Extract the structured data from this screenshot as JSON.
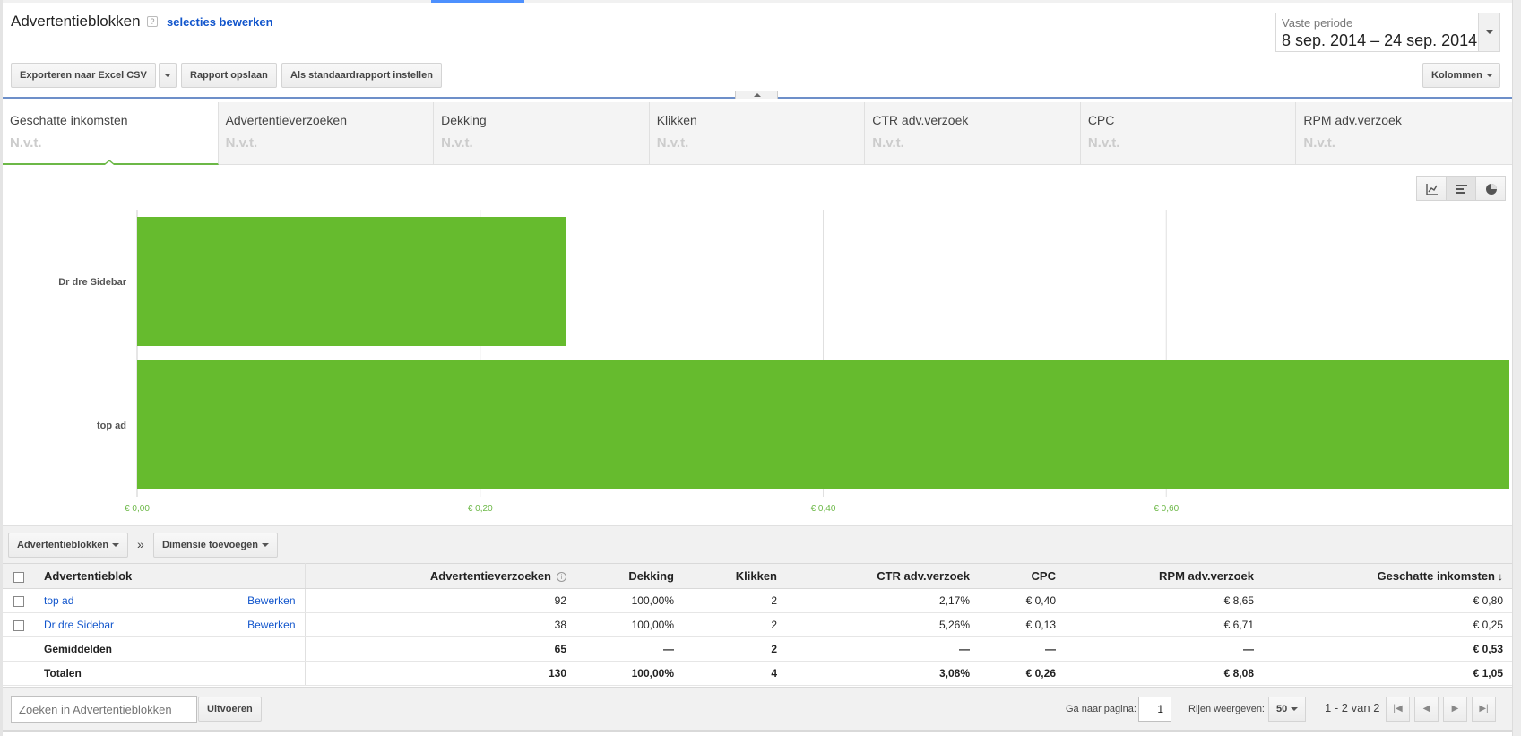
{
  "header": {
    "title": "Advertentieblokken",
    "help": "?",
    "edit_selection": "selecties bewerken",
    "date_label": "Vaste periode",
    "date_value": "8 sep. 2014 – 24 sep. 2014"
  },
  "toolbar": {
    "export": "Exporteren naar Excel CSV",
    "save_report": "Rapport opslaan",
    "set_default": "Als standaardrapport instellen",
    "columns": "Kolommen"
  },
  "metrics": [
    {
      "label": "Geschatte inkomsten",
      "value": "N.v.t."
    },
    {
      "label": "Advertentieverzoeken",
      "value": "N.v.t."
    },
    {
      "label": "Dekking",
      "value": "N.v.t."
    },
    {
      "label": "Klikken",
      "value": "N.v.t."
    },
    {
      "label": "CTR adv.verzoek",
      "value": "N.v.t."
    },
    {
      "label": "CPC",
      "value": "N.v.t."
    },
    {
      "label": "RPM adv.verzoek",
      "value": "N.v.t."
    }
  ],
  "chart_icons": [
    "line-chart-icon",
    "bar-chart-icon",
    "pie-chart-icon"
  ],
  "chart_data": {
    "type": "bar",
    "orientation": "horizontal",
    "categories": [
      "Dr dre Sidebar",
      "top ad"
    ],
    "values": [
      0.25,
      0.8
    ],
    "xlim": [
      0,
      0.8
    ],
    "ticks": [
      0,
      0.2,
      0.4,
      0.6
    ],
    "tick_labels": [
      "€ 0,00",
      "€ 0,20",
      "€ 0,40",
      "€ 0,60"
    ],
    "grid": true,
    "color": "#66bb2e",
    "tick_color": "#6cb847"
  },
  "dimensions": {
    "primary": "Advertentieblokken",
    "separator": "»",
    "add": "Dimensie toevoegen"
  },
  "table": {
    "columns": [
      "Advertentieblok",
      "Advertentieverzoeken",
      "Dekking",
      "Klikken",
      "CTR adv.verzoek",
      "CPC",
      "RPM adv.verzoek",
      "Geschatte inkomsten"
    ],
    "info_mark": "i",
    "sort_mark": "↓",
    "edit_label": "Bewerken",
    "rows": [
      {
        "name": "top ad",
        "cells": [
          "92",
          "100,00%",
          "2",
          "2,17%",
          "€ 0,40",
          "€ 8,65",
          "€ 0,80"
        ]
      },
      {
        "name": "Dr dre Sidebar",
        "cells": [
          "38",
          "100,00%",
          "2",
          "5,26%",
          "€ 0,13",
          "€ 6,71",
          "€ 0,25"
        ]
      }
    ],
    "averages": {
      "name": "Gemiddelden",
      "cells": [
        "65",
        "—",
        "2",
        "—",
        "—",
        "—",
        "€ 0,53"
      ]
    },
    "totals": {
      "name": "Totalen",
      "cells": [
        "130",
        "100,00%",
        "4",
        "3,08%",
        "€ 0,26",
        "€ 8,08",
        "€ 1,05"
      ]
    }
  },
  "footer": {
    "search_placeholder": "Zoeken in Advertentieblokken",
    "run": "Uitvoeren",
    "goto_label": "Ga naar pagina:",
    "page": "1",
    "rows_label": "Rijen weergeven:",
    "rows_value": "50",
    "range": "1 - 2 van 2",
    "nav": [
      "|◀",
      "◀",
      "▶",
      "▶|"
    ]
  }
}
